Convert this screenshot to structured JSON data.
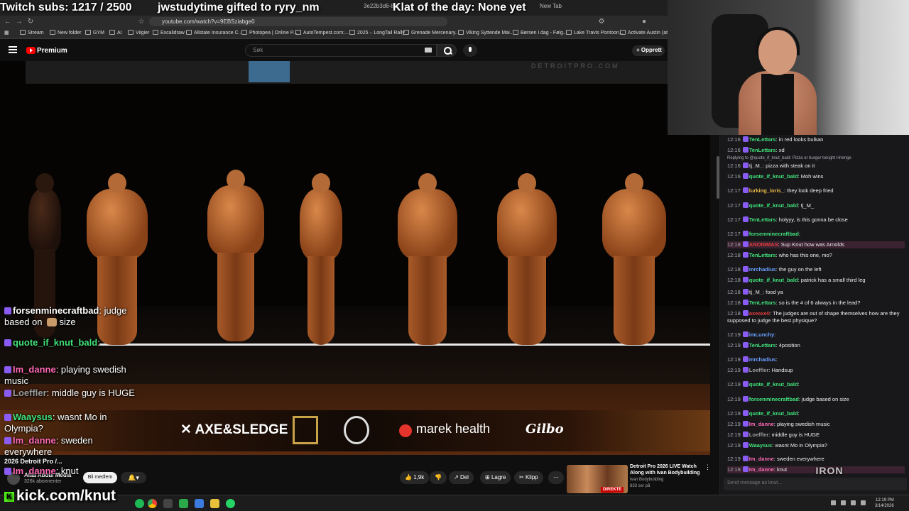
{
  "overlays": {
    "subs_goal": "Twitch subs: 1217 / 2500",
    "gift": "jwstudytime gifted to ryry_nm",
    "klat": "Klat of the day: None yet",
    "kick_url": "kick.com/knut"
  },
  "browser": {
    "tabs": [
      "3e22b3d6-837",
      "New Tab"
    ],
    "url": "youtube.com/watch?v=9EBSziabge0",
    "bookmarks": [
      "Stream",
      "New folder",
      "GYM",
      "AI",
      "Viigier",
      "Excalidraw",
      "Allstate Insurance C...",
      "Photopea | Online P...",
      "AutoTempest.com:...",
      "2025 – LongTail Rally",
      "Grenade Mercenary...",
      "Viking Syttende Mai...",
      "Børsen i dag - Følg...",
      "Lake Travis Pontoon...",
      "Activate Austin (at T..."
    ]
  },
  "youtube": {
    "logo_text": "Premium",
    "search_placeholder": "Søk",
    "create_label": "Opprett",
    "channel_name": "Alaa Abdul Media",
    "channel_subs": "326k abonnenter",
    "member_label": "Bli medlem",
    "likes": "1,9k",
    "share_label": "Del",
    "save_label": "Lagre",
    "clip_label": "Klipp",
    "video_title_overlay": "2026 Detroit Pro /...",
    "sponsors": [
      "AXE&SLEDGE",
      "marek health",
      "Gilbo"
    ],
    "stage_banner": "DETROITPRO.COM",
    "rec": {
      "title": "Detroit Pro 2026 LIVE Watch Along with Ivan Bodybuilding",
      "channel": "Ivan Bodybuilding",
      "views": "833 ser på",
      "badge": "DIREKTE"
    }
  },
  "left_chat": [
    {
      "user": "forsenminecraftbad",
      "user_color": "#ffffff",
      "text": "judge based on",
      "tail": "size"
    },
    {
      "user": "quote_if_knut_bald",
      "user_color": "#41e37a",
      "text": ""
    },
    {
      "user": "Im_danne",
      "user_color": "#ff69b4",
      "text": "playing swedish music"
    },
    {
      "user": "Loeffler",
      "user_color": "#9c9c9c",
      "text": "middle guy is HUGE"
    },
    {
      "user": "Waaysus",
      "user_color": "#41e37a",
      "text": "wasnt Mo in Olympia?"
    },
    {
      "user": "Im_danne",
      "user_color": "#ff69b4",
      "text": "sweden everywhere"
    },
    {
      "user": "Im_danne",
      "user_color": "#ff69b4",
      "text": "knut"
    }
  ],
  "chat": {
    "reply_to": "Replying to @quote_if_knut_bald: Pizza or burger tonight Hmmge",
    "input_placeholder": "Send message as knut...",
    "messages": [
      {
        "time": "12:16",
        "user": "TenLettars",
        "color": "#41e37a",
        "text": "in red looks bulkan"
      },
      {
        "time": "12:16",
        "user": "TenLettars",
        "color": "#41e37a",
        "text": "xd"
      },
      {
        "time": "12:16",
        "user": "tj_M_",
        "color": "#b0b0b0",
        "text": "pizza with steak on it"
      },
      {
        "time": "12:16",
        "user": "quote_if_knut_bald",
        "color": "#41e37a",
        "text": "Moh wins"
      },
      {
        "time": "12:17",
        "user": "lurking_loris_",
        "color": "#e8b84a",
        "text": "they look deep fried"
      },
      {
        "time": "12:17",
        "user": "quote_if_knut_bald",
        "color": "#41e37a",
        "text": "tj_M_"
      },
      {
        "time": "12:17",
        "user": "TenLettars",
        "color": "#41e37a",
        "text": "holyyy, is this gonna be close"
      },
      {
        "time": "12:17",
        "user": "forsenminecraftbad",
        "color": "#41e37a",
        "text": ""
      },
      {
        "time": "12:18",
        "user": "ANONIMAS",
        "color": "#e23c3c",
        "text": "Sup Knut how was Arnolds"
      },
      {
        "time": "12:18",
        "user": "TenLettars",
        "color": "#41e37a",
        "text": "who has this one, mo?"
      },
      {
        "time": "12:18",
        "user": "mrchadius",
        "color": "#6aa0ff",
        "text": "the guy on the left"
      },
      {
        "time": "12:18",
        "user": "quote_if_knut_bald",
        "color": "#41e37a",
        "text": "patrick has a small third leg"
      },
      {
        "time": "12:18",
        "user": "tj_M_",
        "color": "#b0b0b0",
        "text": "food ya"
      },
      {
        "time": "12:18",
        "user": "TenLettars",
        "color": "#41e37a",
        "text": "so is the 4 of 6 always in the lead?"
      },
      {
        "time": "12:18",
        "user": "axeaxe0",
        "color": "#e23c3c",
        "text": "The judges are out of shape themselves how are they"
      },
      {
        "time": "",
        "user": "",
        "color": "#efeff1",
        "text": "supposed to judge the best physique?"
      },
      {
        "time": "12:19",
        "user": "imLunchy",
        "color": "#6aa0ff",
        "text": ""
      },
      {
        "time": "12:19",
        "user": "TenLettars",
        "color": "#41e37a",
        "text": "4position"
      },
      {
        "time": "12:19",
        "user": "mrchadius",
        "color": "#6aa0ff",
        "text": ""
      },
      {
        "time": "12:19",
        "user": "Loeffler",
        "color": "#9c9c9c",
        "text": "Handsup"
      },
      {
        "time": "12:19",
        "user": "quote_if_knut_bald",
        "color": "#41e37a",
        "text": ""
      },
      {
        "time": "12:19",
        "user": "forsenminecraftbad",
        "color": "#41e37a",
        "text": "judge based on      size"
      },
      {
        "time": "12:19",
        "user": "quote_if_knut_bald",
        "color": "#41e37a",
        "text": ""
      },
      {
        "time": "12:19",
        "user": "Im_danne",
        "color": "#ff69b4",
        "text": "playing swedish music"
      },
      {
        "time": "12:19",
        "user": "Loeffler",
        "color": "#9c9c9c",
        "text": "middle guy is HUGE"
      },
      {
        "time": "12:19",
        "user": "Waaysus",
        "color": "#41e37a",
        "text": "wasnt Mo in Olympia?"
      },
      {
        "time": "12:19",
        "user": "Im_danne",
        "color": "#ff69b4",
        "text": "sweden everywhere"
      },
      {
        "time": "12:19",
        "user": "Im_danne",
        "color": "#ff69b4",
        "text": "knut"
      }
    ]
  },
  "taskbar": {
    "time": "12:19 PM",
    "date": "3/14/2026"
  }
}
